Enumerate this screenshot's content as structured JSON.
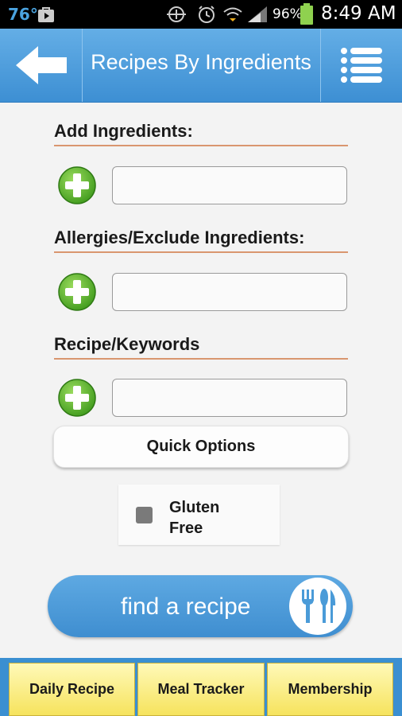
{
  "status_bar": {
    "temperature": "76°",
    "battery": "96%",
    "time": "8:49 AM",
    "icons": [
      "shopping-bag-icon",
      "nfc-icon",
      "alarm-icon",
      "wifi-icon",
      "signal-icon",
      "battery-icon"
    ]
  },
  "header": {
    "title": "Recipes By Ingredients",
    "back_icon": "back-arrow-icon",
    "menu_icon": "menu-list-icon",
    "color": "#4d9edb"
  },
  "sections": {
    "add_ingredients": {
      "title": "Add Ingredients:",
      "value": ""
    },
    "allergies": {
      "title": "Allergies/Exclude Ingredients:",
      "value": ""
    },
    "keywords": {
      "title": "Recipe/Keywords",
      "value": ""
    }
  },
  "quick_options": {
    "label": "Quick Options"
  },
  "gluten_free": {
    "label": "Gluten Free",
    "checked": false
  },
  "find_recipe": {
    "label": "find a recipe",
    "icon": "utensils-icon"
  },
  "bottom_nav": {
    "daily_recipe": "Daily Recipe",
    "meal_tracker": "Meal Tracker",
    "membership": "Membership"
  },
  "colors": {
    "accent_blue": "#3f8ed0",
    "section_underline": "#d9966f",
    "plus_green": "#5cb531",
    "nav_yellow": "#f6e35d"
  }
}
